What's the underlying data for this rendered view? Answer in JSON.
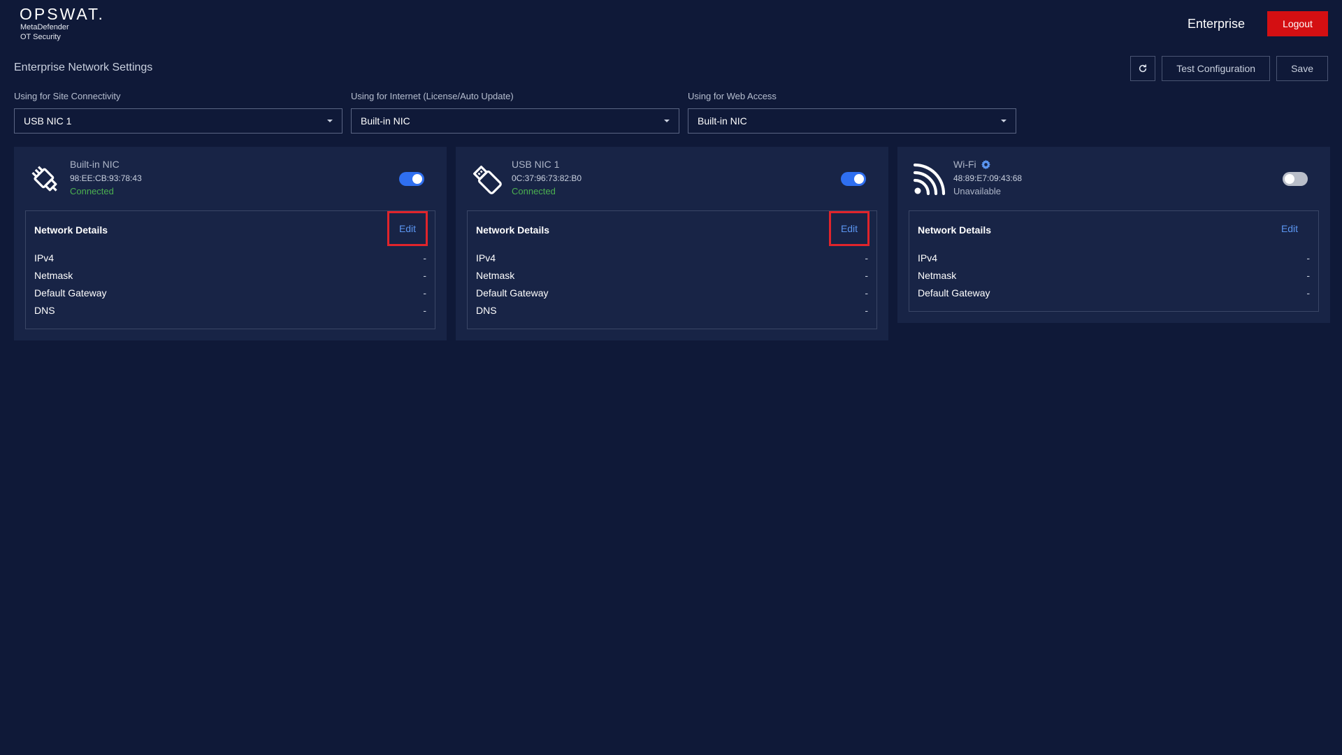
{
  "header": {
    "logo_word": "OPSWAT.",
    "logo_sub1": "MetaDefender",
    "logo_sub2": "OT Security",
    "mode_label": "Enterprise",
    "logout_label": "Logout"
  },
  "page": {
    "title": "Enterprise Network Settings",
    "refresh_icon": "refresh-icon",
    "test_config_label": "Test Configuration",
    "save_label": "Save"
  },
  "selects": [
    {
      "label": "Using for Site Connectivity",
      "value": "USB NIC 1"
    },
    {
      "label": "Using for Internet (License/Auto Update)",
      "value": "Built-in NIC"
    },
    {
      "label": "Using for Web Access",
      "value": "Built-in NIC"
    }
  ],
  "nics": [
    {
      "name": "Built-in NIC",
      "icon": "ethernet-plug-icon",
      "mac": "98:EE:CB:93:78:43",
      "status": "Connected",
      "enabled": true,
      "details_title": "Network Details",
      "edit_label": "Edit",
      "rows": [
        {
          "label": "IPv4",
          "value": "-"
        },
        {
          "label": "Netmask",
          "value": "-"
        },
        {
          "label": "Default Gateway",
          "value": "-"
        },
        {
          "label": "DNS",
          "value": "-"
        }
      ]
    },
    {
      "name": "USB NIC 1",
      "icon": "usb-drive-icon",
      "mac": "0C:37:96:73:82:B0",
      "status": "Connected",
      "enabled": true,
      "details_title": "Network Details",
      "edit_label": "Edit",
      "rows": [
        {
          "label": "IPv4",
          "value": "-"
        },
        {
          "label": "Netmask",
          "value": "-"
        },
        {
          "label": "Default Gateway",
          "value": "-"
        },
        {
          "label": "DNS",
          "value": "-"
        }
      ]
    },
    {
      "name": "Wi-Fi",
      "icon": "wifi-icon",
      "settings_icon": "gear-icon",
      "mac": "48:89:E7:09:43:68",
      "status": "Unavailable",
      "enabled": false,
      "details_title": "Network Details",
      "edit_label": "Edit",
      "rows": [
        {
          "label": "IPv4",
          "value": "-"
        },
        {
          "label": "Netmask",
          "value": "-"
        },
        {
          "label": "Default Gateway",
          "value": "-"
        }
      ]
    }
  ],
  "colors": {
    "background": "#0f1938",
    "card": "#182446",
    "accent": "#2f6ff0",
    "logout": "#d40f12",
    "connected": "#4cb050",
    "highlight": "#e0242b"
  }
}
